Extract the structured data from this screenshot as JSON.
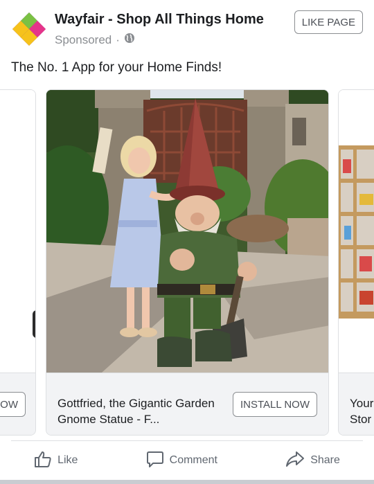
{
  "header": {
    "page_name": "Wayfair - Shop All Things Home",
    "sponsored": "Sponsored",
    "separator": "·",
    "like_page_label": "LIKE PAGE"
  },
  "post": {
    "text": "The No. 1 App for your Home Finds!"
  },
  "carousel": {
    "left_card": {
      "button_partial": "OW"
    },
    "main_card": {
      "title": "Gottfried, the Gigantic Garden Gnome Statue - F...",
      "button_label": "INSTALL NOW"
    },
    "right_card": {
      "title_line1": "Your",
      "title_line2": "Stor"
    }
  },
  "actions": {
    "like": "Like",
    "comment": "Comment",
    "share": "Share"
  },
  "colors": {
    "logo_yellow": "#f6c21b",
    "logo_green": "#7ac143",
    "logo_pink": "#e5348a",
    "logo_purple": "#7b2d8e"
  },
  "icons": [
    "globe-icon",
    "thumbs-up-icon",
    "comment-icon",
    "share-icon"
  ]
}
